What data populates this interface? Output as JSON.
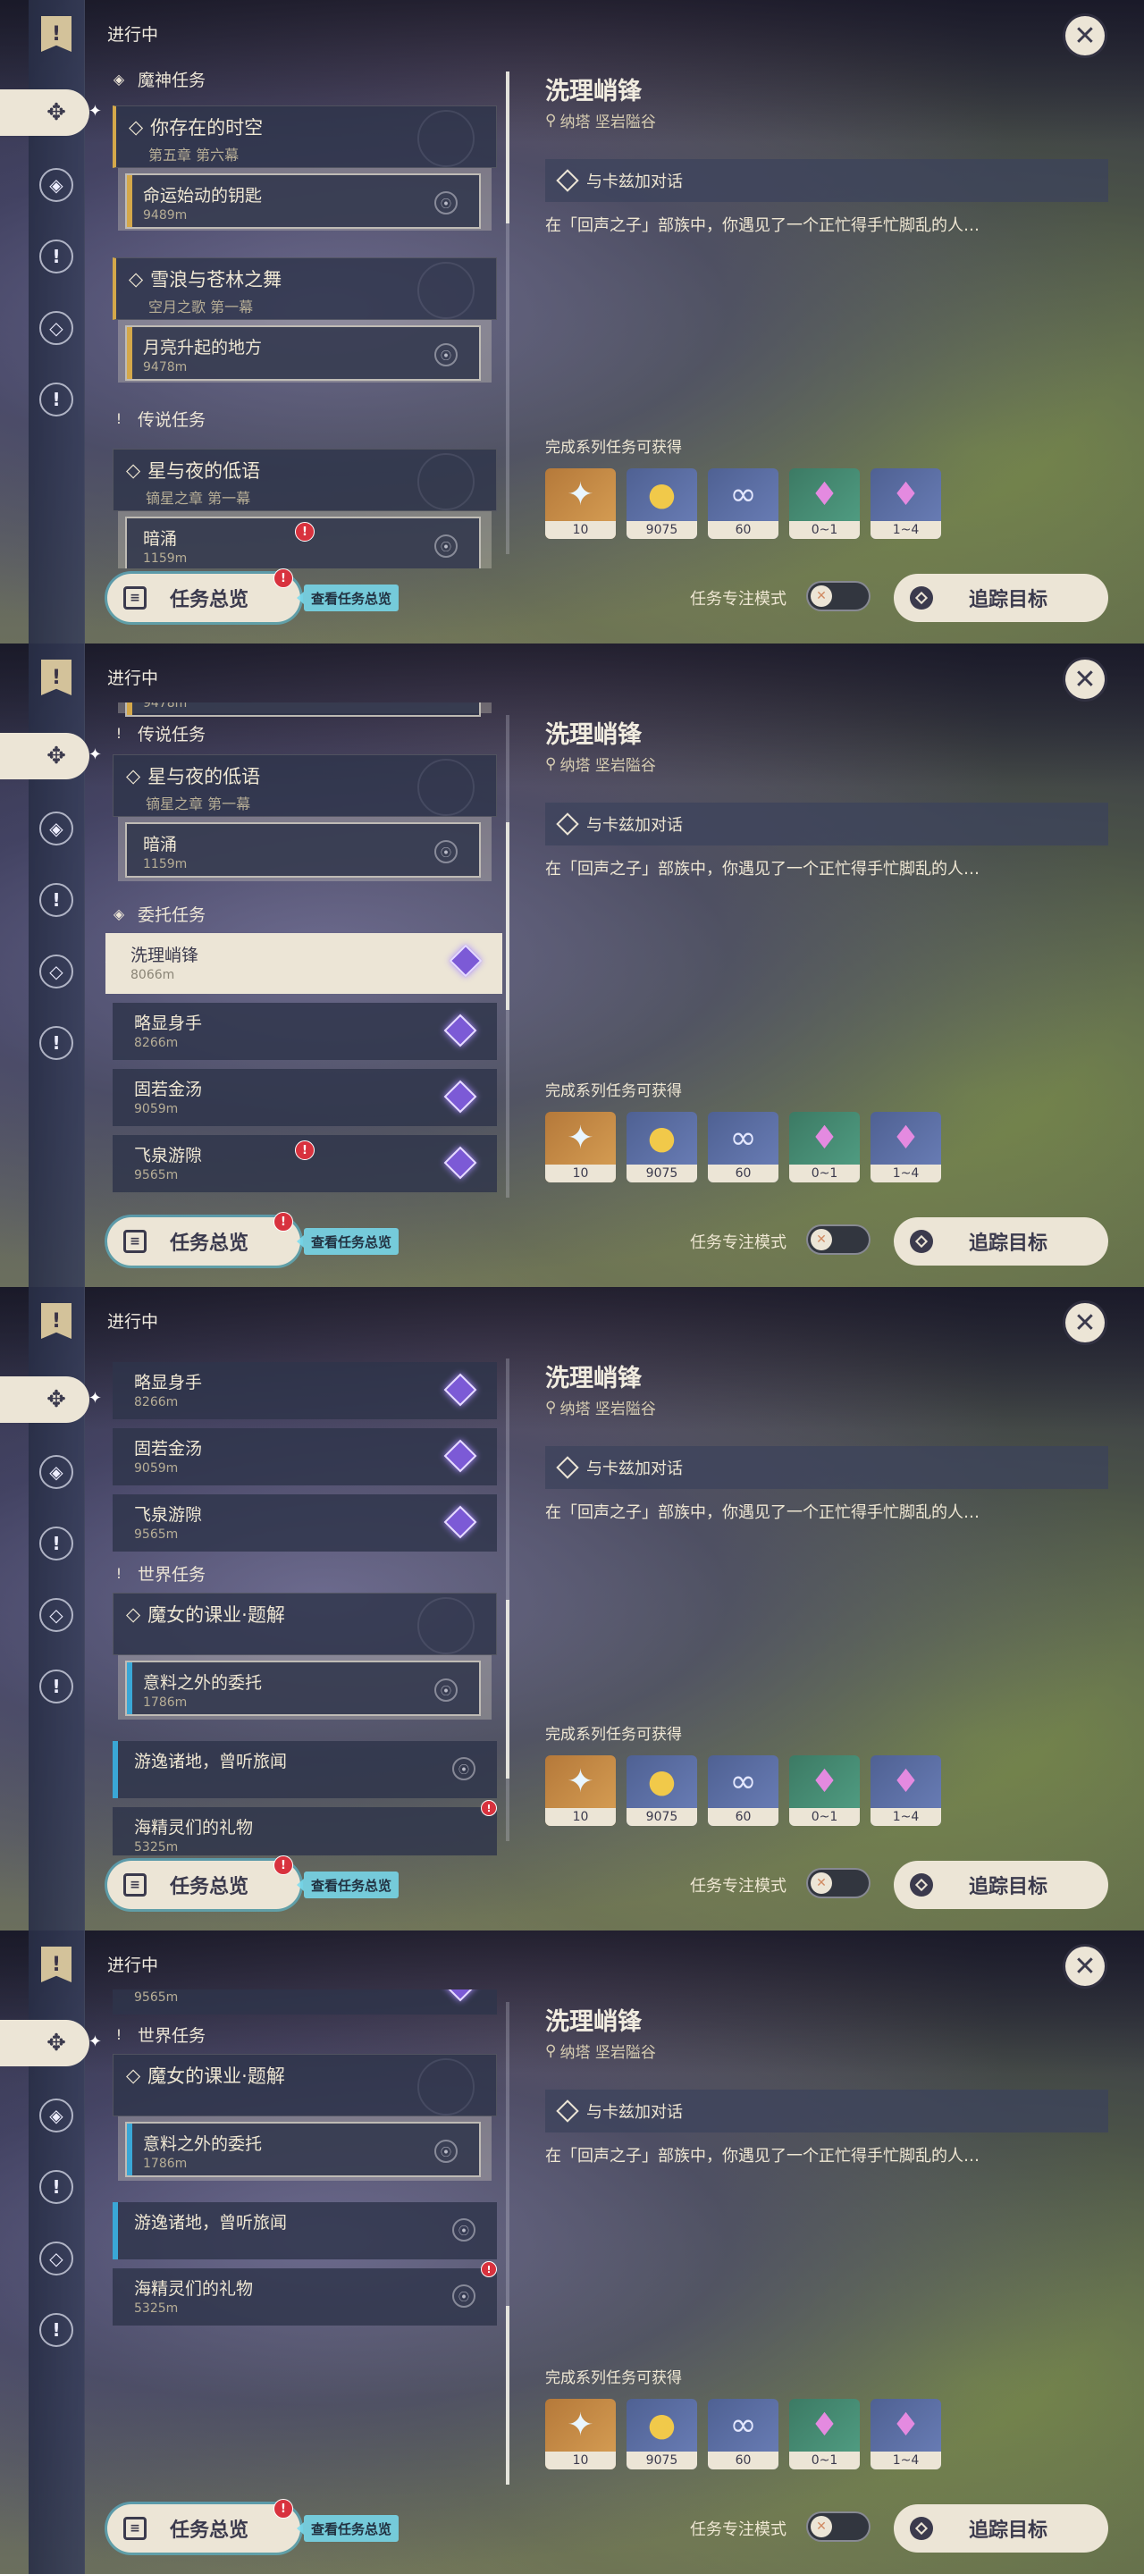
{
  "common": {
    "status_label": "进行中",
    "close_symbol": "✕",
    "sidebar_icons": [
      "quest-book-icon",
      "archon-quest-icon",
      "story-quest-icon",
      "legend-quest-icon",
      "commission-icon",
      "world-quest-icon"
    ],
    "detail": {
      "title": "洗理峭锋",
      "location": "纳塔 坚岩隘谷",
      "objective": "与卡兹加对话",
      "description": "在「回声之子」部族中，你遇见了一个正忙得手忙脚乱的人…",
      "rewards_label": "完成系列任务可获得",
      "rewards": [
        {
          "icon": "adventure-exp-icon",
          "count": "10",
          "color": "#d8a055"
        },
        {
          "icon": "mora-icon",
          "count": "9075",
          "color": "#6b7fb8"
        },
        {
          "icon": "friendship-exp-icon",
          "count": "60",
          "color": "#6b7fb8"
        },
        {
          "icon": "crystal-chunk-icon",
          "count": "0~1",
          "color": "#52a085"
        },
        {
          "icon": "crystal-cluster-icon",
          "count": "1~4",
          "color": "#6b7fb8"
        }
      ]
    },
    "overview_button": "任务总览",
    "overview_hint": "查看任务总览",
    "focus_mode_label": "任务专注模式",
    "track_button": "追踪目标"
  },
  "sections": {
    "archon": "魔神任务",
    "legend": "传说任务",
    "commission": "委托任务",
    "world": "世界任务"
  },
  "quests": {
    "archon1": {
      "title": "你存在的时空",
      "chapter": "第五章 第六幕"
    },
    "archon1_sub": {
      "title": "命运始动的钥匙",
      "distance": "9489m"
    },
    "archon2": {
      "title": "雪浪与苍林之舞",
      "chapter": "空月之歌 第一幕"
    },
    "archon2_sub": {
      "title": "月亮升起的地方",
      "distance": "9478m"
    },
    "archon2_sub_partial": "9478m",
    "legend1": {
      "title": "星与夜的低语",
      "chapter": "镝星之章 第一幕"
    },
    "legend1_sub": {
      "title": "暗涌",
      "distance": "1159m"
    },
    "c1": {
      "title": "洗理峭锋",
      "distance": "8066m"
    },
    "c2": {
      "title": "略显身手",
      "distance": "8266m"
    },
    "c3": {
      "title": "固若金汤",
      "distance": "9059m"
    },
    "c4": {
      "title": "飞泉游隙",
      "distance": "9565m"
    },
    "world1": {
      "title": "魔女的课业·题解"
    },
    "world1_sub": {
      "title": "意料之外的委托",
      "distance": "1786m"
    },
    "world2": {
      "title": "游逸诸地，曾听旅闻"
    },
    "world3": {
      "title": "海精灵们的礼物",
      "distance": "5325m"
    }
  }
}
